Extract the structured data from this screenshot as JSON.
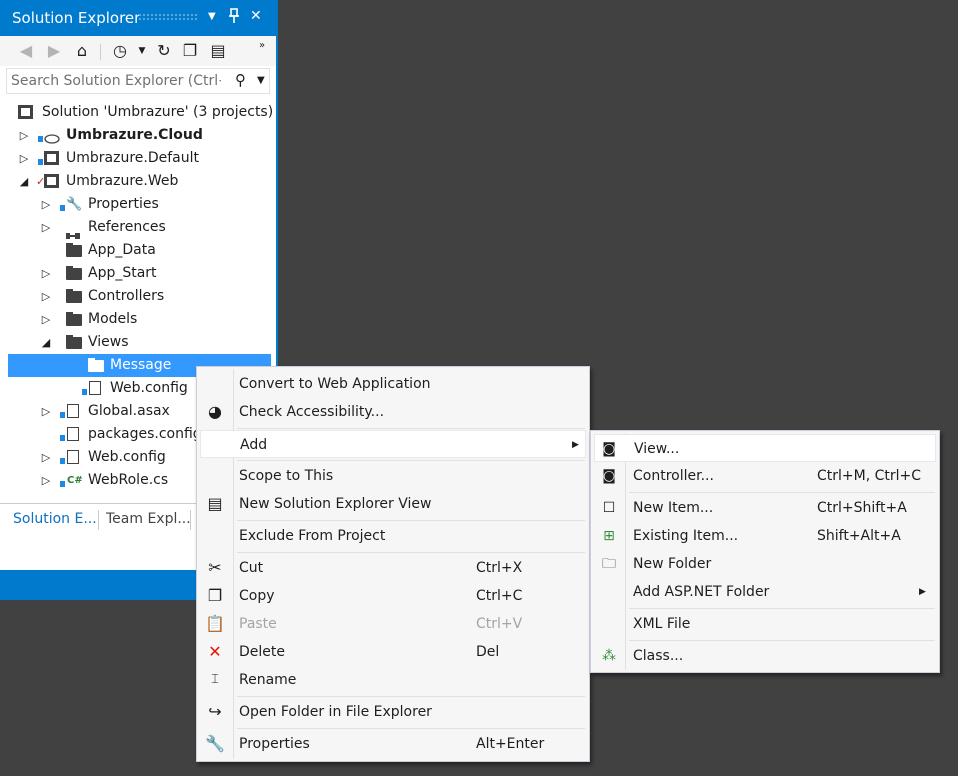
{
  "panel": {
    "title": "Solution Explorer",
    "title_buttons": {
      "dropdown": "▼",
      "pin": "📌",
      "close": "✕"
    },
    "search": {
      "placeholder": "Search Solution Explorer (Ctrl+;)"
    },
    "tree": [
      {
        "label": "Solution 'Umbrazure' (3 projects)"
      },
      {
        "label": "Umbrazure.Cloud"
      },
      {
        "label": "Umbrazure.Default"
      },
      {
        "label": "Umbrazure.Web"
      },
      {
        "label": "Properties"
      },
      {
        "label": "References"
      },
      {
        "label": "App_Data"
      },
      {
        "label": "App_Start"
      },
      {
        "label": "Controllers"
      },
      {
        "label": "Models"
      },
      {
        "label": "Views"
      },
      {
        "label": "Message"
      },
      {
        "label": "Web.config"
      },
      {
        "label": "Global.asax"
      },
      {
        "label": "packages.config"
      },
      {
        "label": "Web.config"
      },
      {
        "label": "WebRole.cs"
      }
    ],
    "bottom_tabs": [
      "Solution E...",
      "Team Expl..."
    ]
  },
  "context_menu": {
    "items": [
      {
        "label": "Convert to Web Application",
        "shortcut": ""
      },
      {
        "label": "Check Accessibility...",
        "shortcut": ""
      },
      {
        "label": "Add",
        "shortcut": ""
      },
      {
        "label": "Scope to This",
        "shortcut": ""
      },
      {
        "label": "New Solution Explorer View",
        "shortcut": ""
      },
      {
        "label": "Exclude From Project",
        "shortcut": ""
      },
      {
        "label": "Cut",
        "shortcut": "Ctrl+X"
      },
      {
        "label": "Copy",
        "shortcut": "Ctrl+C"
      },
      {
        "label": "Paste",
        "shortcut": "Ctrl+V",
        "disabled": true
      },
      {
        "label": "Delete",
        "shortcut": "Del"
      },
      {
        "label": "Rename",
        "shortcut": ""
      },
      {
        "label": "Open Folder in File Explorer",
        "shortcut": ""
      },
      {
        "label": "Properties",
        "shortcut": "Alt+Enter"
      }
    ]
  },
  "add_submenu": {
    "items": [
      {
        "label": "View...",
        "shortcut": ""
      },
      {
        "label": "Controller...",
        "shortcut": "Ctrl+M, Ctrl+C"
      },
      {
        "label": "New Item...",
        "shortcut": "Ctrl+Shift+A"
      },
      {
        "label": "Existing Item...",
        "shortcut": "Shift+Alt+A"
      },
      {
        "label": "New Folder",
        "shortcut": ""
      },
      {
        "label": "Add ASP.NET Folder",
        "shortcut": ""
      },
      {
        "label": "XML File",
        "shortcut": ""
      },
      {
        "label": "Class...",
        "shortcut": ""
      }
    ]
  },
  "colors": {
    "accent": "#007acc",
    "selection": "#3399ff",
    "background": "#414141",
    "menu_bg": "#f6f6f6",
    "delete_red": "#e51400"
  }
}
